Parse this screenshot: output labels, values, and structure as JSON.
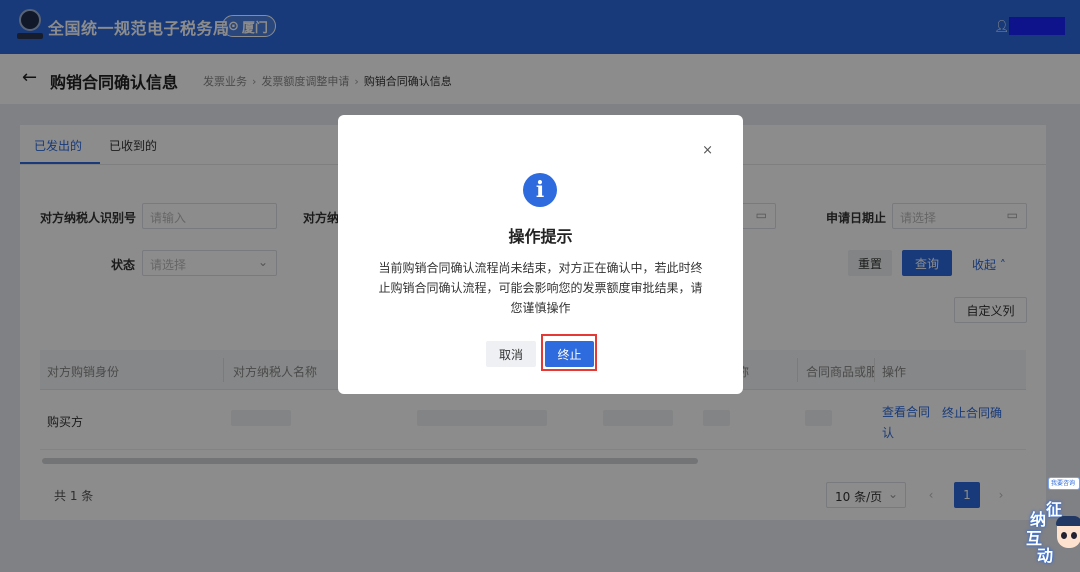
{
  "header": {
    "app_title": "全国统一规范电子税务局",
    "region": "厦门",
    "region_icon": "location-pin-icon",
    "user_icon": "user-icon",
    "brand_color": "#2d6bde"
  },
  "breadcrumb_bar": {
    "page_title": "购销合同确认信息",
    "crumbs": [
      "发票业务",
      "发票额度调整申请",
      "购销合同确认信息"
    ]
  },
  "tabs": [
    {
      "label": "已发出的",
      "active": true
    },
    {
      "label": "已收到的",
      "active": false
    }
  ],
  "filters": {
    "taxpayer_id_label": "对方纳税人识别号",
    "taxpayer_id_placeholder": "请输入",
    "taxpayer_name_label": "对方纳",
    "date_end_label": "申请日期止",
    "date_end_placeholder": "请选择",
    "status_label": "状态",
    "status_placeholder": "请选择"
  },
  "actions": {
    "reset": "重置",
    "query": "查询",
    "collapse": "收起",
    "custom_columns": "自定义列"
  },
  "table": {
    "columns": [
      "对方购销身份",
      "对方纳税人名称",
      "称",
      "合同商品或服",
      "操作"
    ],
    "rows": [
      {
        "role": "购买方",
        "op_view": "查看合同",
        "op_stop": "终止合同确认"
      }
    ]
  },
  "pagination": {
    "total": "共 1 条",
    "page_size": "10 条/页",
    "current_page": "1",
    "prev": "‹",
    "next": "›"
  },
  "dialog": {
    "icon": "info-icon",
    "title": "操作提示",
    "message": "当前购销合同确认流程尚未结束，对方正在确认中，若此时终止购销合同确认流程，可能会影响您的发票额度审批结果，请您谨慎操作",
    "cancel": "取消",
    "confirm": "终止",
    "close": "×"
  },
  "float_widget": {
    "tag": "我要咨询",
    "chars": [
      "征",
      "纳",
      "互",
      "动"
    ]
  }
}
